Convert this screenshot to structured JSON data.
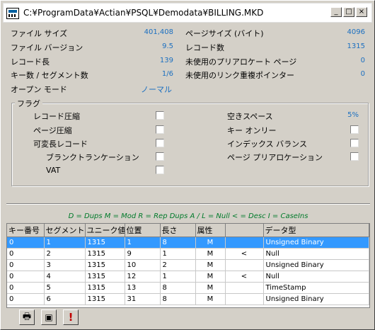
{
  "window": {
    "title": "C:¥ProgramData¥Actian¥PSQL¥Demodata¥BILLING.MKD",
    "minimize": "_",
    "maximize": "□",
    "close": "×"
  },
  "stats": {
    "file_size_label": "ファイル サイズ",
    "file_size_value": "401,408",
    "file_version_label": "ファイル バージョン",
    "file_version_value": "9.5",
    "record_length_label": "レコード長",
    "record_length_value": "139",
    "keys_segments_label": "キー数 / セグメント数",
    "keys_segments_value": "1/6",
    "open_mode_label": "オープン モード",
    "open_mode_value": "ノーマル",
    "page_size_label": "ページサイズ (バイト)",
    "page_size_value": "4096",
    "record_count_label": "レコード数",
    "record_count_value": "1315",
    "unused_prealloc_label": "未使用のプリアロケート ページ",
    "unused_prealloc_value": "0",
    "unused_dup_ptr_label": "未使用のリンク重複ポインター",
    "unused_dup_ptr_value": "0"
  },
  "flags": {
    "legend": "フラグ",
    "record_compression": "レコード圧縮",
    "page_compression": "ページ圧縮",
    "variable_length": "可変長レコード",
    "blank_truncation": "ブランクトランケーション",
    "vat": "VAT",
    "free_space_label": "空きスペース",
    "free_space_value": "5%",
    "key_only": "キー オンリー",
    "index_balance": "インデックス バランス",
    "page_preallocation": "ページ プリアロケーション"
  },
  "legend_text": "D = Dups   M = Mod   R = Rep  Dups   A / L = Null   < = Desc   I = CaseIns",
  "table": {
    "headers": [
      "キー番号",
      "セグメント",
      "ユニーク値",
      "位置",
      "長さ",
      "属性",
      "",
      "データ型"
    ],
    "rows": [
      [
        "0",
        "1",
        "1315",
        "1",
        "8",
        "M",
        "",
        "Unsigned Binary"
      ],
      [
        "0",
        "2",
        "1315",
        "9",
        "1",
        "M",
        "<",
        "Null"
      ],
      [
        "0",
        "3",
        "1315",
        "10",
        "2",
        "M",
        "",
        "Unsigned Binary"
      ],
      [
        "0",
        "4",
        "1315",
        "12",
        "1",
        "M",
        "<",
        "Null"
      ],
      [
        "0",
        "5",
        "1315",
        "13",
        "8",
        "M",
        "",
        "TimeStamp"
      ],
      [
        "0",
        "6",
        "1315",
        "31",
        "8",
        "M",
        "",
        "Unsigned Binary"
      ]
    ]
  },
  "toolbar": {
    "print_icon": "🖶",
    "save_icon": "▣",
    "alert_icon": "!"
  }
}
